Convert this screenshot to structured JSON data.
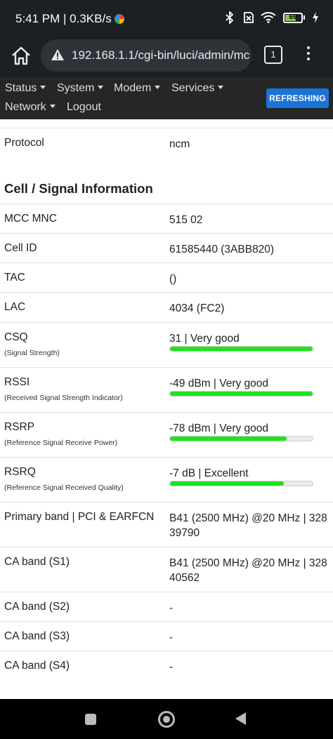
{
  "status_bar": {
    "time": "5:41 PM | 0.3KB/s",
    "battery": "69",
    "battery_level": 0.69,
    "icons": [
      "bluetooth-icon",
      "no-sim-icon",
      "wifi-icon",
      "battery-icon",
      "charging-bolt-icon"
    ]
  },
  "browser": {
    "url": "192.168.1.1/cgi-bin/luci/admin/mc",
    "tab_count": "1"
  },
  "nav": {
    "items": [
      {
        "label": "Status",
        "dropdown": true
      },
      {
        "label": "System",
        "dropdown": true
      },
      {
        "label": "Modem",
        "dropdown": true
      },
      {
        "label": "Services",
        "dropdown": true
      },
      {
        "label": "Network",
        "dropdown": true
      },
      {
        "label": "Logout",
        "dropdown": false
      }
    ],
    "refresh_label": "REFRESHING",
    "refresh_color": "#1a73d9"
  },
  "protocol": {
    "label": "Protocol",
    "value": "ncm"
  },
  "section_title": "Cell / Signal Information",
  "rows": [
    {
      "label": "MCC MNC",
      "value": "515 02"
    },
    {
      "label": "Cell ID",
      "value": "61585440 (3ABB820)"
    },
    {
      "label": "TAC",
      "value": "()"
    },
    {
      "label": "LAC",
      "value": "4034 (FC2)"
    },
    {
      "label": "CSQ",
      "sublabel": "(Signal Strength)",
      "value": "31 | Very good",
      "level": 1.0
    },
    {
      "label": "RSSI",
      "sublabel": "(Received Signal Strength Indicator)",
      "value": "-49 dBm | Very good",
      "level": 1.0
    },
    {
      "label": "RSRP",
      "sublabel": "(Reference Signal Receive Power)",
      "value": "-78 dBm | Very good",
      "level": 0.82
    },
    {
      "label": "RSRQ",
      "sublabel": "(Reference Signal Received Quality)",
      "value": "-7 dB | Excellent",
      "level": 0.8
    },
    {
      "label": "Primary band | PCI & EARFCN",
      "value": "B41 (2500 MHz) @20 MHz | 328 39790"
    },
    {
      "label": "CA band (S1)",
      "value": "B41 (2500 MHz) @20 MHz | 328 40562"
    },
    {
      "label": "CA band (S2)",
      "value": "-"
    },
    {
      "label": "CA band (S3)",
      "value": "-"
    },
    {
      "label": "CA band (S4)",
      "value": "-"
    }
  ],
  "colors": {
    "bar_fill": "#1ee31e",
    "nav_bg": "#262626",
    "chrome_bg": "#1c1f24"
  }
}
